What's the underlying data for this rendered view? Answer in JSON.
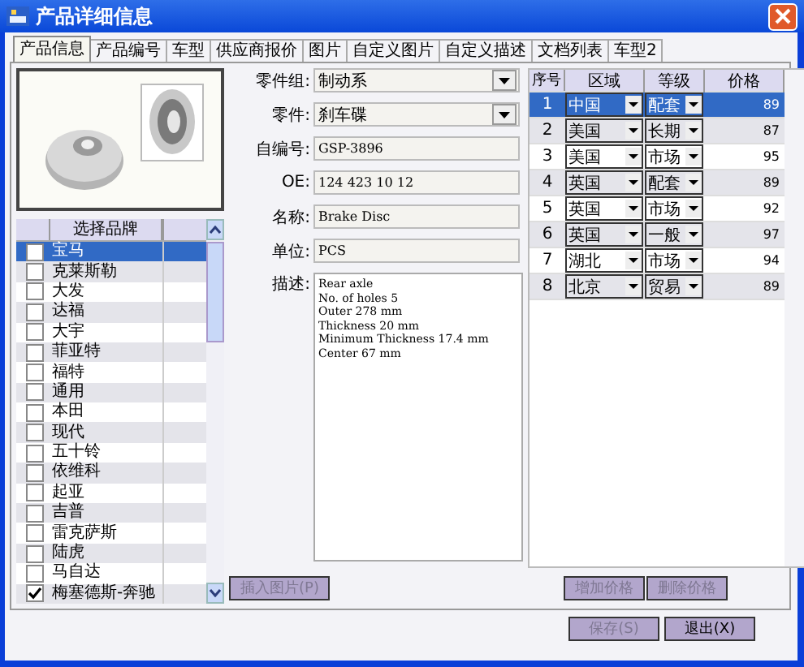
{
  "window": {
    "title": "产品详细信息"
  },
  "tabs": [
    {
      "label": "产品信息",
      "selected": true
    },
    {
      "label": "产品编号",
      "selected": false
    },
    {
      "label": "车型",
      "selected": false
    },
    {
      "label": "供应商报价",
      "selected": false
    },
    {
      "label": "图片",
      "selected": false
    },
    {
      "label": "自定义图片",
      "selected": false
    },
    {
      "label": "自定义描述",
      "selected": false
    },
    {
      "label": "文档列表",
      "selected": false
    },
    {
      "label": "车型2",
      "selected": false
    }
  ],
  "brand_list": {
    "header": "选择品牌",
    "rows": [
      {
        "name": "宝马",
        "checked": false,
        "selected": true
      },
      {
        "name": "克莱斯勒",
        "checked": false,
        "selected": false
      },
      {
        "name": "大发",
        "checked": false,
        "selected": false
      },
      {
        "name": "达福",
        "checked": false,
        "selected": false
      },
      {
        "name": "大宇",
        "checked": false,
        "selected": false
      },
      {
        "name": "菲亚特",
        "checked": false,
        "selected": false
      },
      {
        "name": "福特",
        "checked": false,
        "selected": false
      },
      {
        "name": "通用",
        "checked": false,
        "selected": false
      },
      {
        "name": "本田",
        "checked": false,
        "selected": false
      },
      {
        "name": "现代",
        "checked": false,
        "selected": false
      },
      {
        "name": "五十铃",
        "checked": false,
        "selected": false
      },
      {
        "name": "依维科",
        "checked": false,
        "selected": false
      },
      {
        "name": "起亚",
        "checked": false,
        "selected": false
      },
      {
        "name": "吉普",
        "checked": false,
        "selected": false
      },
      {
        "name": "雷克萨斯",
        "checked": false,
        "selected": false
      },
      {
        "name": "陆虎",
        "checked": false,
        "selected": false
      },
      {
        "name": "马自达",
        "checked": false,
        "selected": false
      },
      {
        "name": "梅塞德斯-奔驰",
        "checked": true,
        "selected": false
      }
    ]
  },
  "fields": [
    {
      "label": "零件组:",
      "value": "制动系",
      "kind": "dropdown"
    },
    {
      "label": "零件:",
      "value": "刹车碟",
      "kind": "dropdown"
    },
    {
      "label": "自编号:",
      "value": "GSP-3896",
      "kind": "text"
    },
    {
      "label": "OE:",
      "value": "124 423 10 12",
      "kind": "text"
    },
    {
      "label": "名称:",
      "value": "Brake Disc",
      "kind": "text"
    },
    {
      "label": "单位:",
      "value": "PCS",
      "kind": "text"
    },
    {
      "label": "描述:",
      "value": "Rear axle\nNo. of holes 5\nOuter 278 mm\nThickness 20 mm\nMinimum Thickness 17.4 mm\nCenter 67 mm",
      "kind": "multiline"
    }
  ],
  "insert_picture_button": {
    "label": "插入图片(P)",
    "disabled": true
  },
  "price_table": {
    "columns": [
      "序号",
      "区域",
      "等级",
      "价格"
    ],
    "rows": [
      {
        "no": "1",
        "region": "中国",
        "grade": "配套",
        "price": "89",
        "selected": true
      },
      {
        "no": "2",
        "region": "美国",
        "grade": "长期",
        "price": "87",
        "selected": false
      },
      {
        "no": "3",
        "region": "美国",
        "grade": "市场",
        "price": "95",
        "selected": false
      },
      {
        "no": "4",
        "region": "英国",
        "grade": "配套",
        "price": "89",
        "selected": false
      },
      {
        "no": "5",
        "region": "英国",
        "grade": "市场",
        "price": "92",
        "selected": false
      },
      {
        "no": "6",
        "region": "英国",
        "grade": "一般",
        "price": "97",
        "selected": false
      },
      {
        "no": "7",
        "region": "湖北",
        "grade": "市场",
        "price": "94",
        "selected": false
      },
      {
        "no": "8",
        "region": "北京",
        "grade": "贸易",
        "price": "89",
        "selected": false
      }
    ]
  },
  "price_buttons": [
    {
      "label": "增加价格",
      "disabled": true
    },
    {
      "label": "删除价格",
      "disabled": true
    }
  ],
  "footer_buttons": [
    {
      "label": "保存(S)",
      "disabled": true
    },
    {
      "label": "退出(X)",
      "disabled": false
    }
  ]
}
